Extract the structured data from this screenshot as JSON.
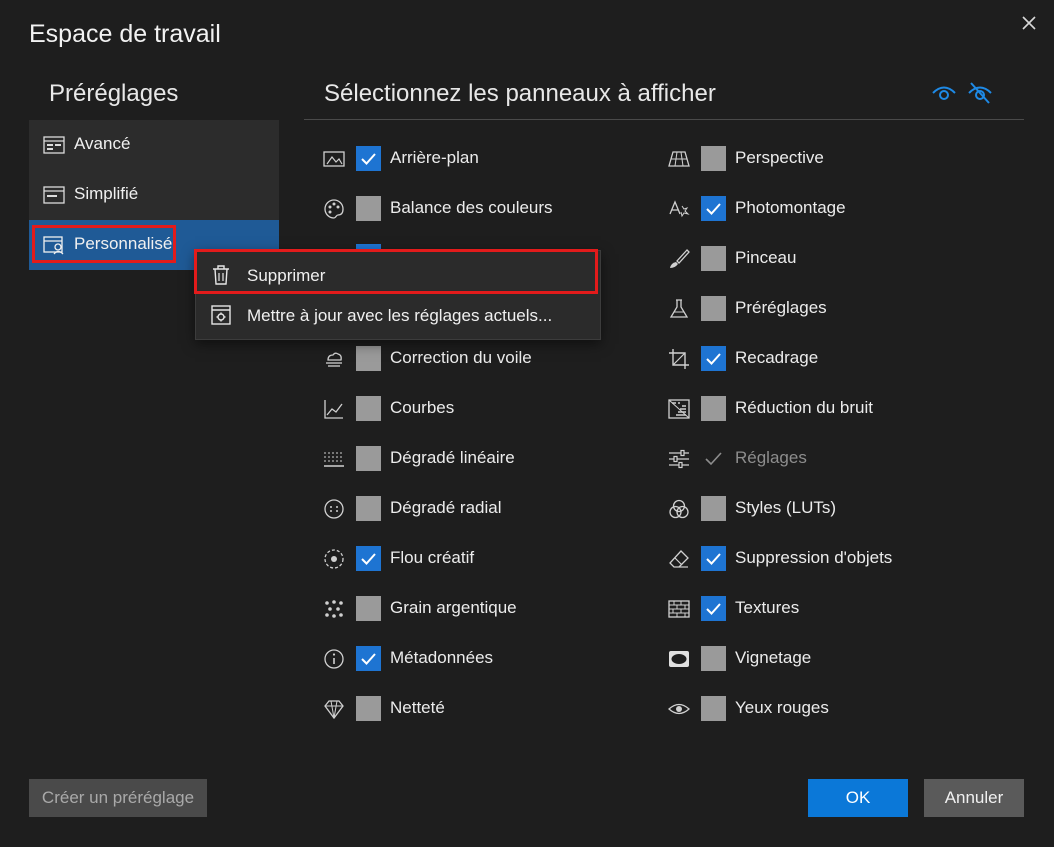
{
  "dialog": {
    "title": "Espace de travail"
  },
  "presets": {
    "title": "Préréglages",
    "items": [
      {
        "label": "Avancé"
      },
      {
        "label": "Simplifié"
      },
      {
        "label": "Personnalisé"
      }
    ]
  },
  "panels": {
    "title": "Sélectionnez les panneaux à afficher",
    "left": [
      {
        "label": "Arrière-plan",
        "checked": true,
        "icon": "background-icon"
      },
      {
        "label": "Balance des couleurs",
        "checked": false,
        "icon": "palette-icon"
      },
      {
        "label": "",
        "checked": true,
        "icon": "hidden-icon"
      },
      {
        "label": "",
        "checked": false,
        "icon": "hidden-icon"
      },
      {
        "label": "Correction du voile",
        "checked": false,
        "icon": "haze-icon"
      },
      {
        "label": "Courbes",
        "checked": false,
        "icon": "curves-icon"
      },
      {
        "label": "Dégradé linéaire",
        "checked": false,
        "icon": "linear-gradient-icon"
      },
      {
        "label": "Dégradé radial",
        "checked": false,
        "icon": "radial-gradient-icon"
      },
      {
        "label": "Flou créatif",
        "checked": true,
        "icon": "creative-blur-icon"
      },
      {
        "label": "Grain argentique",
        "checked": false,
        "icon": "grain-icon"
      },
      {
        "label": "Métadonnées",
        "checked": true,
        "icon": "info-icon"
      },
      {
        "label": "Netteté",
        "checked": false,
        "icon": "diamond-icon"
      }
    ],
    "right": [
      {
        "label": "Perspective",
        "checked": false,
        "icon": "perspective-icon"
      },
      {
        "label": "Photomontage",
        "checked": true,
        "icon": "photomontage-icon"
      },
      {
        "label": "Pinceau",
        "checked": false,
        "icon": "brush-icon"
      },
      {
        "label": "Préréglages",
        "checked": false,
        "icon": "flask-icon"
      },
      {
        "label": "Recadrage",
        "checked": true,
        "icon": "crop-icon"
      },
      {
        "label": "Réduction du bruit",
        "checked": false,
        "icon": "noise-reduction-icon"
      },
      {
        "label": "Réglages",
        "checked": "locked",
        "icon": "sliders-icon"
      },
      {
        "label": "Styles (LUTs)",
        "checked": false,
        "icon": "styles-icon"
      },
      {
        "label": "Suppression d'objets",
        "checked": true,
        "icon": "eraser-icon"
      },
      {
        "label": "Textures",
        "checked": true,
        "icon": "brick-icon"
      },
      {
        "label": "Vignetage",
        "checked": false,
        "icon": "vignette-icon"
      },
      {
        "label": "Yeux rouges",
        "checked": false,
        "icon": "eye-icon"
      }
    ]
  },
  "context_menu": {
    "delete_label": "Supprimer",
    "update_label": "Mettre à jour avec les réglages actuels..."
  },
  "buttons": {
    "create": "Créer un préréglage",
    "ok": "OK",
    "cancel": "Annuler"
  },
  "colors": {
    "accent": "#1e74d2",
    "highlight": "#e31b1b",
    "selected_preset": "#1f5a96"
  }
}
